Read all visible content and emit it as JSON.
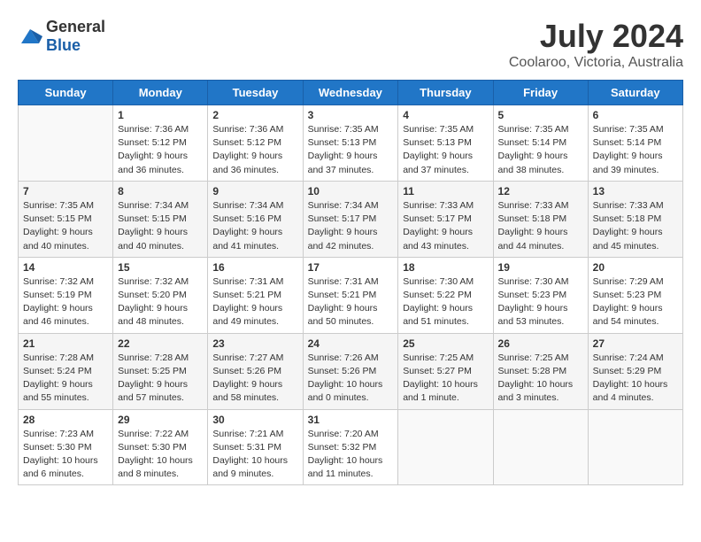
{
  "logo": {
    "general": "General",
    "blue": "Blue"
  },
  "title": "July 2024",
  "location": "Coolaroo, Victoria, Australia",
  "days_of_week": [
    "Sunday",
    "Monday",
    "Tuesday",
    "Wednesday",
    "Thursday",
    "Friday",
    "Saturday"
  ],
  "weeks": [
    [
      {
        "day": "",
        "sunrise": "",
        "sunset": "",
        "daylight": ""
      },
      {
        "day": "1",
        "sunrise": "Sunrise: 7:36 AM",
        "sunset": "Sunset: 5:12 PM",
        "daylight": "Daylight: 9 hours and 36 minutes."
      },
      {
        "day": "2",
        "sunrise": "Sunrise: 7:36 AM",
        "sunset": "Sunset: 5:12 PM",
        "daylight": "Daylight: 9 hours and 36 minutes."
      },
      {
        "day": "3",
        "sunrise": "Sunrise: 7:35 AM",
        "sunset": "Sunset: 5:13 PM",
        "daylight": "Daylight: 9 hours and 37 minutes."
      },
      {
        "day": "4",
        "sunrise": "Sunrise: 7:35 AM",
        "sunset": "Sunset: 5:13 PM",
        "daylight": "Daylight: 9 hours and 37 minutes."
      },
      {
        "day": "5",
        "sunrise": "Sunrise: 7:35 AM",
        "sunset": "Sunset: 5:14 PM",
        "daylight": "Daylight: 9 hours and 38 minutes."
      },
      {
        "day": "6",
        "sunrise": "Sunrise: 7:35 AM",
        "sunset": "Sunset: 5:14 PM",
        "daylight": "Daylight: 9 hours and 39 minutes."
      }
    ],
    [
      {
        "day": "7",
        "sunrise": "Sunrise: 7:35 AM",
        "sunset": "Sunset: 5:15 PM",
        "daylight": "Daylight: 9 hours and 40 minutes."
      },
      {
        "day": "8",
        "sunrise": "Sunrise: 7:34 AM",
        "sunset": "Sunset: 5:15 PM",
        "daylight": "Daylight: 9 hours and 40 minutes."
      },
      {
        "day": "9",
        "sunrise": "Sunrise: 7:34 AM",
        "sunset": "Sunset: 5:16 PM",
        "daylight": "Daylight: 9 hours and 41 minutes."
      },
      {
        "day": "10",
        "sunrise": "Sunrise: 7:34 AM",
        "sunset": "Sunset: 5:17 PM",
        "daylight": "Daylight: 9 hours and 42 minutes."
      },
      {
        "day": "11",
        "sunrise": "Sunrise: 7:33 AM",
        "sunset": "Sunset: 5:17 PM",
        "daylight": "Daylight: 9 hours and 43 minutes."
      },
      {
        "day": "12",
        "sunrise": "Sunrise: 7:33 AM",
        "sunset": "Sunset: 5:18 PM",
        "daylight": "Daylight: 9 hours and 44 minutes."
      },
      {
        "day": "13",
        "sunrise": "Sunrise: 7:33 AM",
        "sunset": "Sunset: 5:18 PM",
        "daylight": "Daylight: 9 hours and 45 minutes."
      }
    ],
    [
      {
        "day": "14",
        "sunrise": "Sunrise: 7:32 AM",
        "sunset": "Sunset: 5:19 PM",
        "daylight": "Daylight: 9 hours and 46 minutes."
      },
      {
        "day": "15",
        "sunrise": "Sunrise: 7:32 AM",
        "sunset": "Sunset: 5:20 PM",
        "daylight": "Daylight: 9 hours and 48 minutes."
      },
      {
        "day": "16",
        "sunrise": "Sunrise: 7:31 AM",
        "sunset": "Sunset: 5:21 PM",
        "daylight": "Daylight: 9 hours and 49 minutes."
      },
      {
        "day": "17",
        "sunrise": "Sunrise: 7:31 AM",
        "sunset": "Sunset: 5:21 PM",
        "daylight": "Daylight: 9 hours and 50 minutes."
      },
      {
        "day": "18",
        "sunrise": "Sunrise: 7:30 AM",
        "sunset": "Sunset: 5:22 PM",
        "daylight": "Daylight: 9 hours and 51 minutes."
      },
      {
        "day": "19",
        "sunrise": "Sunrise: 7:30 AM",
        "sunset": "Sunset: 5:23 PM",
        "daylight": "Daylight: 9 hours and 53 minutes."
      },
      {
        "day": "20",
        "sunrise": "Sunrise: 7:29 AM",
        "sunset": "Sunset: 5:23 PM",
        "daylight": "Daylight: 9 hours and 54 minutes."
      }
    ],
    [
      {
        "day": "21",
        "sunrise": "Sunrise: 7:28 AM",
        "sunset": "Sunset: 5:24 PM",
        "daylight": "Daylight: 9 hours and 55 minutes."
      },
      {
        "day": "22",
        "sunrise": "Sunrise: 7:28 AM",
        "sunset": "Sunset: 5:25 PM",
        "daylight": "Daylight: 9 hours and 57 minutes."
      },
      {
        "day": "23",
        "sunrise": "Sunrise: 7:27 AM",
        "sunset": "Sunset: 5:26 PM",
        "daylight": "Daylight: 9 hours and 58 minutes."
      },
      {
        "day": "24",
        "sunrise": "Sunrise: 7:26 AM",
        "sunset": "Sunset: 5:26 PM",
        "daylight": "Daylight: 10 hours and 0 minutes."
      },
      {
        "day": "25",
        "sunrise": "Sunrise: 7:25 AM",
        "sunset": "Sunset: 5:27 PM",
        "daylight": "Daylight: 10 hours and 1 minute."
      },
      {
        "day": "26",
        "sunrise": "Sunrise: 7:25 AM",
        "sunset": "Sunset: 5:28 PM",
        "daylight": "Daylight: 10 hours and 3 minutes."
      },
      {
        "day": "27",
        "sunrise": "Sunrise: 7:24 AM",
        "sunset": "Sunset: 5:29 PM",
        "daylight": "Daylight: 10 hours and 4 minutes."
      }
    ],
    [
      {
        "day": "28",
        "sunrise": "Sunrise: 7:23 AM",
        "sunset": "Sunset: 5:30 PM",
        "daylight": "Daylight: 10 hours and 6 minutes."
      },
      {
        "day": "29",
        "sunrise": "Sunrise: 7:22 AM",
        "sunset": "Sunset: 5:30 PM",
        "daylight": "Daylight: 10 hours and 8 minutes."
      },
      {
        "day": "30",
        "sunrise": "Sunrise: 7:21 AM",
        "sunset": "Sunset: 5:31 PM",
        "daylight": "Daylight: 10 hours and 9 minutes."
      },
      {
        "day": "31",
        "sunrise": "Sunrise: 7:20 AM",
        "sunset": "Sunset: 5:32 PM",
        "daylight": "Daylight: 10 hours and 11 minutes."
      },
      {
        "day": "",
        "sunrise": "",
        "sunset": "",
        "daylight": ""
      },
      {
        "day": "",
        "sunrise": "",
        "sunset": "",
        "daylight": ""
      },
      {
        "day": "",
        "sunrise": "",
        "sunset": "",
        "daylight": ""
      }
    ]
  ]
}
